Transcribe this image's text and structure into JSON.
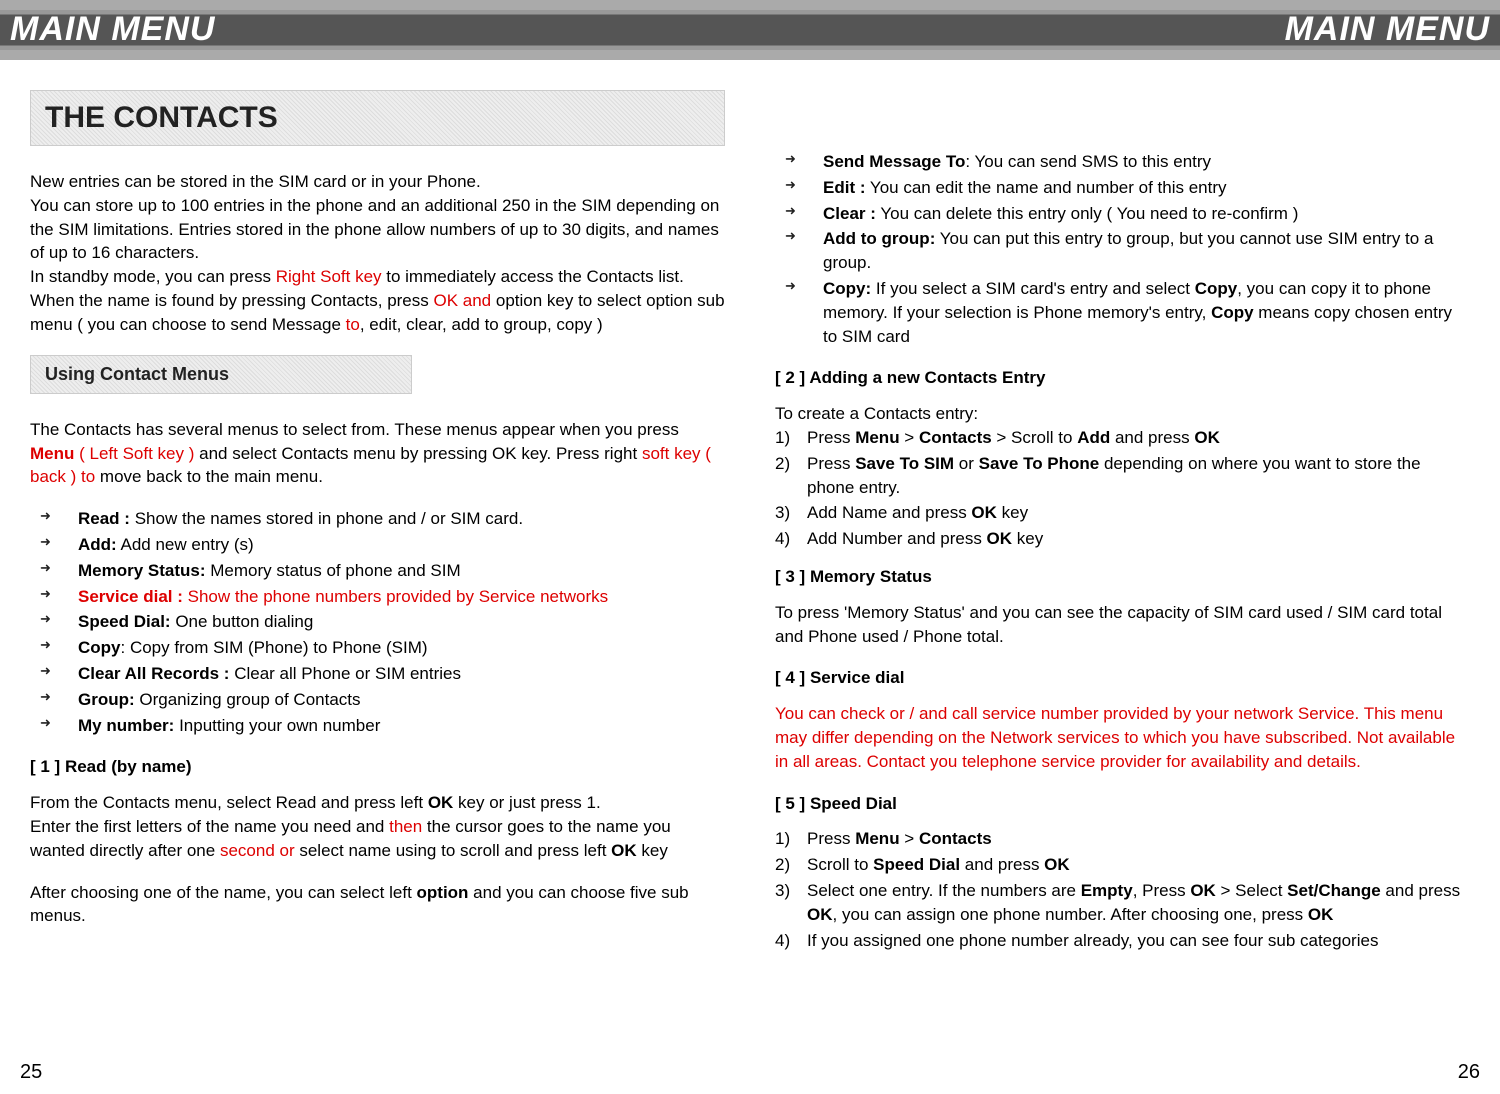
{
  "banner": {
    "left": "MAIN MENU",
    "right": "MAIN MENU"
  },
  "left": {
    "title": "THE CONTACTS",
    "intro_a": "New entries can be stored in the SIM card or in your Phone.",
    "intro_b": "You can store up to 100 entries in the phone and an additional 250 in the SIM depending on the SIM limitations. Entries stored in the phone allow numbers of up to 30 digits, and names of up to 16 characters.",
    "intro_c1": "In standby mode, you can press ",
    "intro_c2_red": "Right Soft key",
    "intro_c3": " to immediately access the Contacts list. When the name is found by pressing Contacts, press ",
    "intro_c4_red": "OK and",
    "intro_c5": " option key to select option sub menu ( you can choose to send Message ",
    "intro_c6_red": "to",
    "intro_c7": ", edit, clear, add to group, copy )",
    "sub_title": "Using Contact Menus",
    "menus_a1": "The Contacts has several menus to select from. These menus appear when you press ",
    "menus_a2_red_bold": "Menu",
    "menus_a3_red": " ( Left Soft key )",
    "menus_a4": " and select Contacts menu by pressing OK  key. Press right  ",
    "menus_a5_red": "soft key ( back ) to",
    "menus_a6": " move back to the main menu.",
    "bullets": [
      {
        "b": "Read :",
        "t": " Show the names stored in phone and / or SIM card."
      },
      {
        "b": "Add:",
        "t": " Add new entry (s)"
      },
      {
        "b": "Memory Status:",
        "t": " Memory status of phone and SIM"
      },
      {
        "b_red": "Service dial :",
        "t_red": " Show the phone numbers provided by Service networks"
      },
      {
        "b": "Speed Dial:",
        "t": " One button dialing"
      },
      {
        "b": "Copy",
        "t": ": Copy from SIM (Phone) to Phone (SIM)"
      },
      {
        "b": "Clear All Records :",
        "t": " Clear all Phone or SIM entries"
      },
      {
        "b": "Group:",
        "t": " Organizing group of Contacts"
      },
      {
        "b": "My number:",
        "t": " Inputting your own number"
      }
    ],
    "h1": "[ 1 ]  Read (by name)",
    "r1a": "From the Contacts menu, select Read and press left ",
    "r1b_bold": "OK",
    "r1c": " key or just press 1.",
    "r2a": "Enter the first letters of the name you need and ",
    "r2b_red": "then",
    "r2c": " the cursor goes to the name you wanted directly after one ",
    "r2d_red": "second or",
    "r2e": " select name using to scroll and press left  ",
    "r2f_bold": "OK",
    "r2g": " key",
    "r3a": "After choosing one of the name, you can select left  ",
    "r3b_bold": "option",
    "r3c": " and you can choose five sub menus."
  },
  "right": {
    "bullets2": [
      {
        "b": "Send Message To",
        "t": ": You can send SMS to this entry"
      },
      {
        "b": "Edit :",
        "t": " You can edit the name and number of this entry"
      },
      {
        "b": "Clear :",
        "t": " You can delete this entry only ( You need to re-confirm )"
      },
      {
        "b": "Add to group:",
        "t": " You can put this entry to group, but you cannot use SIM entry to a group."
      },
      {
        "b": "Copy:",
        "t1": " If you select a SIM card's entry and select ",
        "b2": "Copy",
        "t2": ", you can copy it to phone memory. If your selection is Phone memory's entry, ",
        "b3": "Copy",
        "t3": " means copy chosen entry to SIM card"
      }
    ],
    "h2": "[ 2 ]  Adding a new Contacts Entry",
    "a2_intro": "To create a Contacts entry:",
    "a2_steps": [
      {
        "n": "1)",
        "p": [
          {
            "t": "  Press "
          },
          {
            "b": "Menu"
          },
          {
            "t": " > "
          },
          {
            "b": "Contacts"
          },
          {
            "t": " > Scroll to "
          },
          {
            "b": "Add"
          },
          {
            "t": " and press "
          },
          {
            "b": "OK"
          }
        ]
      },
      {
        "n": "2)",
        "p": [
          {
            "t": "  Press "
          },
          {
            "b": "Save To SIM"
          },
          {
            "t": " or "
          },
          {
            "b": "Save To Phone"
          },
          {
            "t": " depending on where you want to store the phone entry."
          }
        ]
      },
      {
        "n": "3)",
        "p": [
          {
            "t": "  Add Name and press "
          },
          {
            "b": "OK"
          },
          {
            "t": " key"
          }
        ]
      },
      {
        "n": "4)",
        "p": [
          {
            "t": "  Add Number and press "
          },
          {
            "b": "OK"
          },
          {
            "t": " key"
          }
        ]
      }
    ],
    "h3": "[ 3 ]  Memory Status",
    "m3": "To press 'Memory Status' and you can see the capacity of SIM card used / SIM card total and Phone used / Phone total.",
    "h4": "[ 4 ]  Service dial",
    "s4_red": "You can check or / and call service number provided by your network Service. This menu may differ depending on the Network services to which you have subscribed. Not available in all areas. Contact you telephone service provider for availability and details.",
    "h5": "[ 5 ]  Speed Dial",
    "a5_steps": [
      {
        "n": "1)",
        "p": [
          {
            "t": "  Press "
          },
          {
            "b": "Menu"
          },
          {
            "t": " > "
          },
          {
            "b": "Contacts"
          }
        ]
      },
      {
        "n": "2)",
        "p": [
          {
            "t": "  Scroll to "
          },
          {
            "b": "Speed Dial"
          },
          {
            "t": " and press "
          },
          {
            "b": "OK"
          }
        ]
      },
      {
        "n": "3)",
        "p": [
          {
            "t": "  Select one entry. If the numbers are "
          },
          {
            "b": "Empty"
          },
          {
            "t": ", Press "
          },
          {
            "b": "OK"
          },
          {
            "t": " > Select "
          },
          {
            "b": "Set/Change"
          },
          {
            "t": " and press "
          },
          {
            "b": "OK"
          },
          {
            "t": ", you can assign one phone number. After choosing one, press "
          },
          {
            "b": "OK"
          }
        ]
      },
      {
        "n": "4)",
        "p": [
          {
            "t": "  If you assigned one phone number already, you can see four sub categories"
          }
        ]
      }
    ]
  },
  "pageNums": {
    "left": "25",
    "right": "26"
  }
}
